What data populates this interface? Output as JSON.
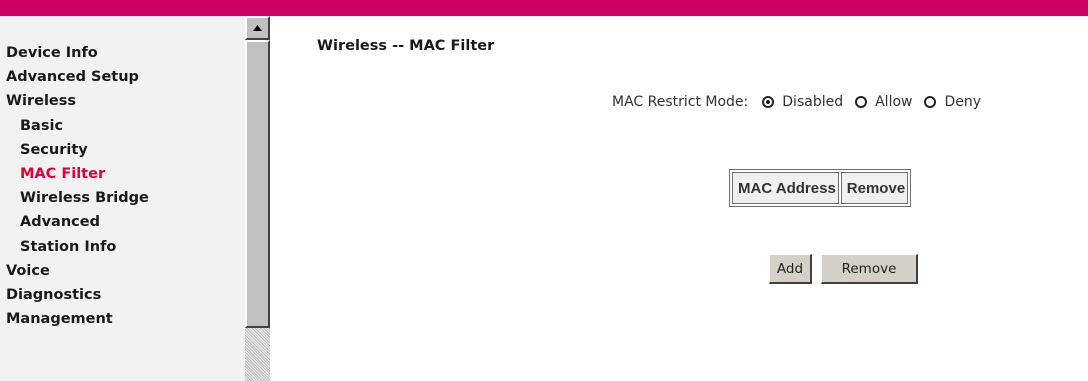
{
  "colors": {
    "topbar": "#cc0066",
    "active_nav": "#e0003c"
  },
  "sidebar": {
    "items": [
      {
        "label": "Device Info",
        "level": 0,
        "active": false
      },
      {
        "label": "Advanced Setup",
        "level": 0,
        "active": false
      },
      {
        "label": "Wireless",
        "level": 0,
        "active": false
      },
      {
        "label": "Basic",
        "level": 1,
        "active": false
      },
      {
        "label": "Security",
        "level": 1,
        "active": false
      },
      {
        "label": "MAC Filter",
        "level": 1,
        "active": true
      },
      {
        "label": "Wireless Bridge",
        "level": 1,
        "active": false
      },
      {
        "label": "Advanced",
        "level": 1,
        "active": false
      },
      {
        "label": "Station Info",
        "level": 1,
        "active": false
      },
      {
        "label": "Voice",
        "level": 0,
        "active": false
      },
      {
        "label": "Diagnostics",
        "level": 0,
        "active": false
      },
      {
        "label": "Management",
        "level": 0,
        "active": false
      }
    ]
  },
  "main": {
    "title": "Wireless -- MAC Filter",
    "restrict": {
      "label": "MAC Restrict Mode:",
      "options": [
        "Disabled",
        "Allow",
        "Deny"
      ],
      "selected": "Disabled"
    },
    "table": {
      "headers": [
        "MAC Address",
        "Remove"
      ]
    },
    "buttons": {
      "add": "Add",
      "remove": "Remove"
    }
  },
  "icons": {
    "scroll_up": "triangle-up-icon"
  }
}
